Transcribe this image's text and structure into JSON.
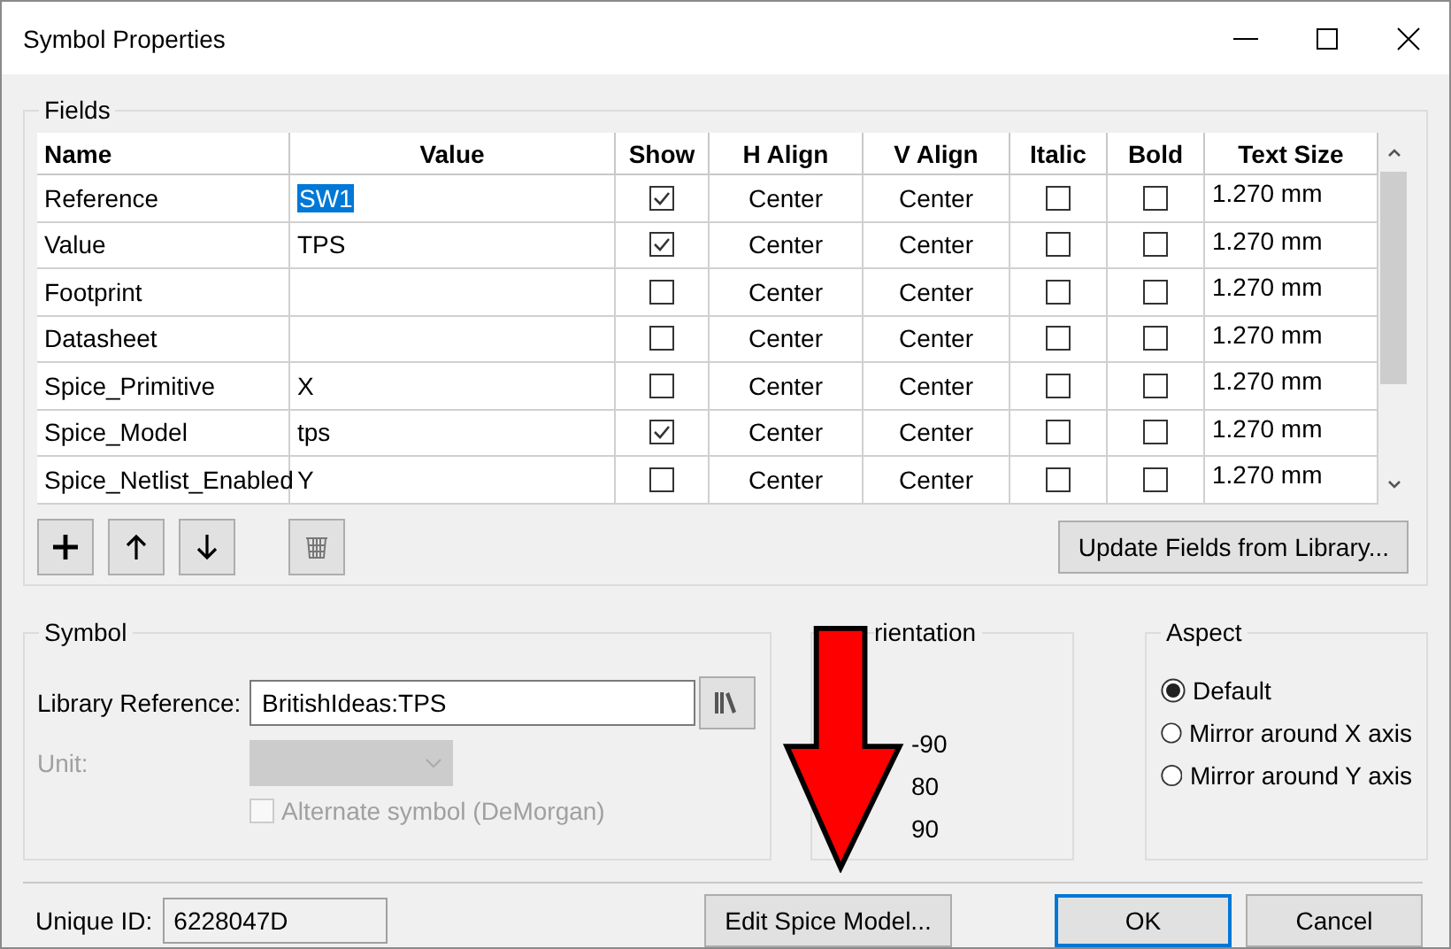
{
  "window": {
    "title": "Symbol Properties"
  },
  "fields": {
    "label": "Fields",
    "columns": [
      "Name",
      "Value",
      "Show",
      "H Align",
      "V Align",
      "Italic",
      "Bold",
      "Text Size"
    ],
    "rows": [
      {
        "name": "Reference",
        "value": "SW1",
        "value_selected": true,
        "show": true,
        "h_align": "Center",
        "v_align": "Center",
        "italic": false,
        "bold": false,
        "text_size": "1.270 mm"
      },
      {
        "name": "Value",
        "value": "TPS",
        "value_selected": false,
        "show": true,
        "h_align": "Center",
        "v_align": "Center",
        "italic": false,
        "bold": false,
        "text_size": "1.270 mm"
      },
      {
        "name": "Footprint",
        "show": false,
        "h_align": "Center",
        "v_align": "Center",
        "italic": false,
        "bold": false,
        "text_size": "1.270 mm"
      },
      {
        "name": "Datasheet",
        "show": false,
        "h_align": "Center",
        "v_align": "Center",
        "italic": false,
        "bold": false,
        "text_size": "1.270 mm"
      },
      {
        "name": "Spice_Primitive",
        "value": "X",
        "value_selected": false,
        "show": false,
        "h_align": "Center",
        "v_align": "Center",
        "italic": false,
        "bold": false,
        "text_size": "1.270 mm"
      },
      {
        "name": "Spice_Model",
        "value": "tps",
        "value_selected": false,
        "show": true,
        "h_align": "Center",
        "v_align": "Center",
        "italic": false,
        "bold": false,
        "text_size": "1.270 mm"
      },
      {
        "name": "Spice_Netlist_Enabled",
        "value": "Y",
        "value_selected": false,
        "show": false,
        "h_align": "Center",
        "v_align": "Center",
        "italic": false,
        "bold": false,
        "text_size": "1.270 mm"
      }
    ],
    "update_button": "Update Fields from Library..."
  },
  "symbol": {
    "label": "Symbol",
    "library_reference_label": "Library Reference:",
    "library_reference": "BritishIdeas:TPS",
    "unit_label": "Unit:",
    "unit_disabled": true,
    "alternate_label": "Alternate symbol (DeMorgan)",
    "alternate_checked": false
  },
  "orientation": {
    "label": "rientation",
    "visible_texts": [
      "-90",
      "80",
      "90"
    ]
  },
  "aspect": {
    "label": "Aspect",
    "options": [
      {
        "label": "Default",
        "selected": true
      },
      {
        "label": "Mirror around X axis",
        "selected": false
      },
      {
        "label": "Mirror around Y axis",
        "selected": false
      }
    ]
  },
  "footer": {
    "unique_id_label": "Unique ID:",
    "unique_id": "6228047D",
    "buttons": [
      {
        "label": "Edit Spice Model...",
        "default": false
      },
      {
        "label": "OK",
        "default": true
      },
      {
        "label": "Cancel",
        "default": false
      }
    ]
  }
}
